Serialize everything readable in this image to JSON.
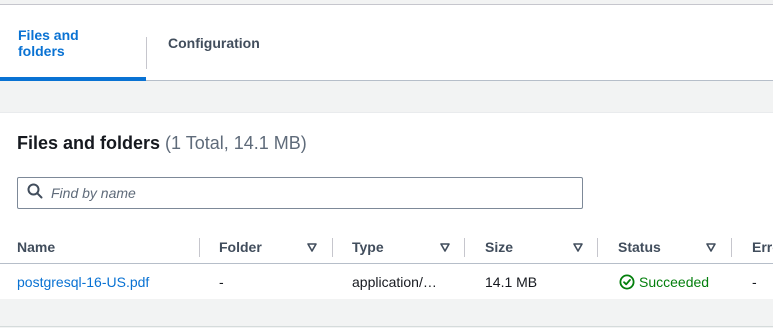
{
  "tabs": [
    {
      "label": "Files and folders",
      "active": true
    },
    {
      "label": "Configuration",
      "active": false
    }
  ],
  "section": {
    "title": "Files and folders",
    "counter": "(1 Total, 14.1 MB)"
  },
  "search": {
    "placeholder": "Find by name",
    "value": ""
  },
  "table": {
    "columns": [
      "Name",
      "Folder",
      "Type",
      "Size",
      "Status",
      "Erro"
    ],
    "rows": [
      {
        "name": "postgresql-16-US.pdf",
        "folder": "-",
        "type": "application/…",
        "size": "14.1 MB",
        "status": "Succeeded",
        "error": "-"
      }
    ]
  },
  "colors": {
    "link": "#0972d3",
    "success": "#037f0c",
    "heading": "#414d5c"
  },
  "icons": {
    "search": "search-icon",
    "sort": "caret-down-icon",
    "status": "status-success-icon"
  }
}
